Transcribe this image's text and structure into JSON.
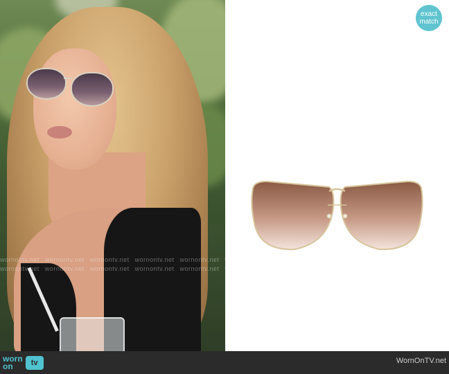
{
  "badge": {
    "line1": "exact",
    "line2": "match"
  },
  "watermark": {
    "text": "wornontv.net"
  },
  "footer": {
    "logo_line1": "worn",
    "logo_line2": "on",
    "logo_tv": "tv",
    "site_name": "WornOnTV.net"
  },
  "colors": {
    "accent": "#5fc4cf",
    "footer_bg": "#2b2b2b",
    "lens_top": "#8a5a44",
    "lens_bottom": "#f3e4dc",
    "frame": "#d6c49a"
  }
}
